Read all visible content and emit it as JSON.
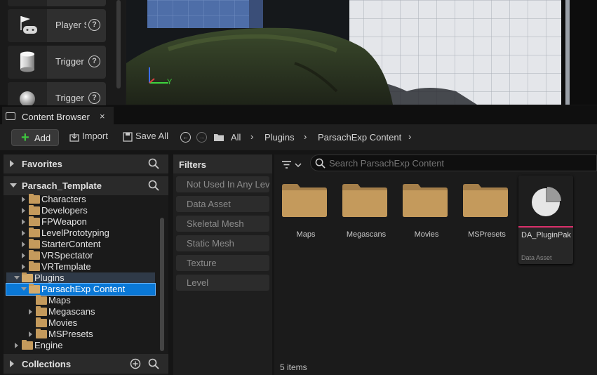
{
  "place_actors": {
    "items": [
      {
        "label": "Player Start",
        "icon": "flag-gamepad-icon"
      },
      {
        "label": "Trigger",
        "icon": "cylinder-icon"
      },
      {
        "label": "Trigger",
        "icon": "sphere-icon"
      }
    ],
    "help_glyph": "?"
  },
  "viewport": {
    "axis_y_label": "Y"
  },
  "content_browser": {
    "tab_label": "Content Browser",
    "close_glyph": "×",
    "toolbar": {
      "add_label": "Add",
      "add_glyph": "+",
      "import_label": "Import",
      "save_all_label": "Save All"
    },
    "breadcrumbs": [
      "All",
      "Plugins",
      "ParsachExp Content"
    ],
    "breadcrumb_separator": "›",
    "sources": {
      "favorites_label": "Favorites",
      "project_label": "Parsach_Template",
      "collections_label": "Collections",
      "tree": [
        {
          "label": "Characters",
          "depth": 1,
          "expander": "right"
        },
        {
          "label": "Developers",
          "depth": 1,
          "expander": "right"
        },
        {
          "label": "FPWeapon",
          "depth": 1,
          "expander": "right"
        },
        {
          "label": "LevelPrototyping",
          "depth": 1,
          "expander": "right"
        },
        {
          "label": "StarterContent",
          "depth": 1,
          "expander": "right"
        },
        {
          "label": "VRSpectator",
          "depth": 1,
          "expander": "right"
        },
        {
          "label": "VRTemplate",
          "depth": 1,
          "expander": "right"
        },
        {
          "label": "Plugins",
          "depth": 0,
          "expander": "down",
          "open": true,
          "state": "parent"
        },
        {
          "label": "ParsachExp Content",
          "depth": 1,
          "expander": "down",
          "open": true,
          "state": "selected"
        },
        {
          "label": "Maps",
          "depth": 2,
          "expander": "none"
        },
        {
          "label": "Megascans",
          "depth": 2,
          "expander": "right"
        },
        {
          "label": "Movies",
          "depth": 2,
          "expander": "none"
        },
        {
          "label": "MSPresets",
          "depth": 2,
          "expander": "right"
        },
        {
          "label": "Engine",
          "depth": 0,
          "expander": "right"
        }
      ]
    },
    "filters": {
      "title": "Filters",
      "items": [
        "Not Used In Any Level",
        "Data Asset",
        "Skeletal Mesh",
        "Static Mesh",
        "Texture",
        "Level"
      ]
    },
    "assets": {
      "search_placeholder": "Search ParsachExp Content",
      "folders": [
        "Maps",
        "Megascans",
        "Movies",
        "MSPresets"
      ],
      "data_asset": {
        "name": "DA_PluginPak",
        "type": "Data Asset",
        "accent": "#d9306b"
      },
      "items_count": "5 items"
    },
    "colors": {
      "folder": "#c49a5c",
      "selection": "#0a78d6",
      "add_plus": "#3ec43e"
    }
  }
}
